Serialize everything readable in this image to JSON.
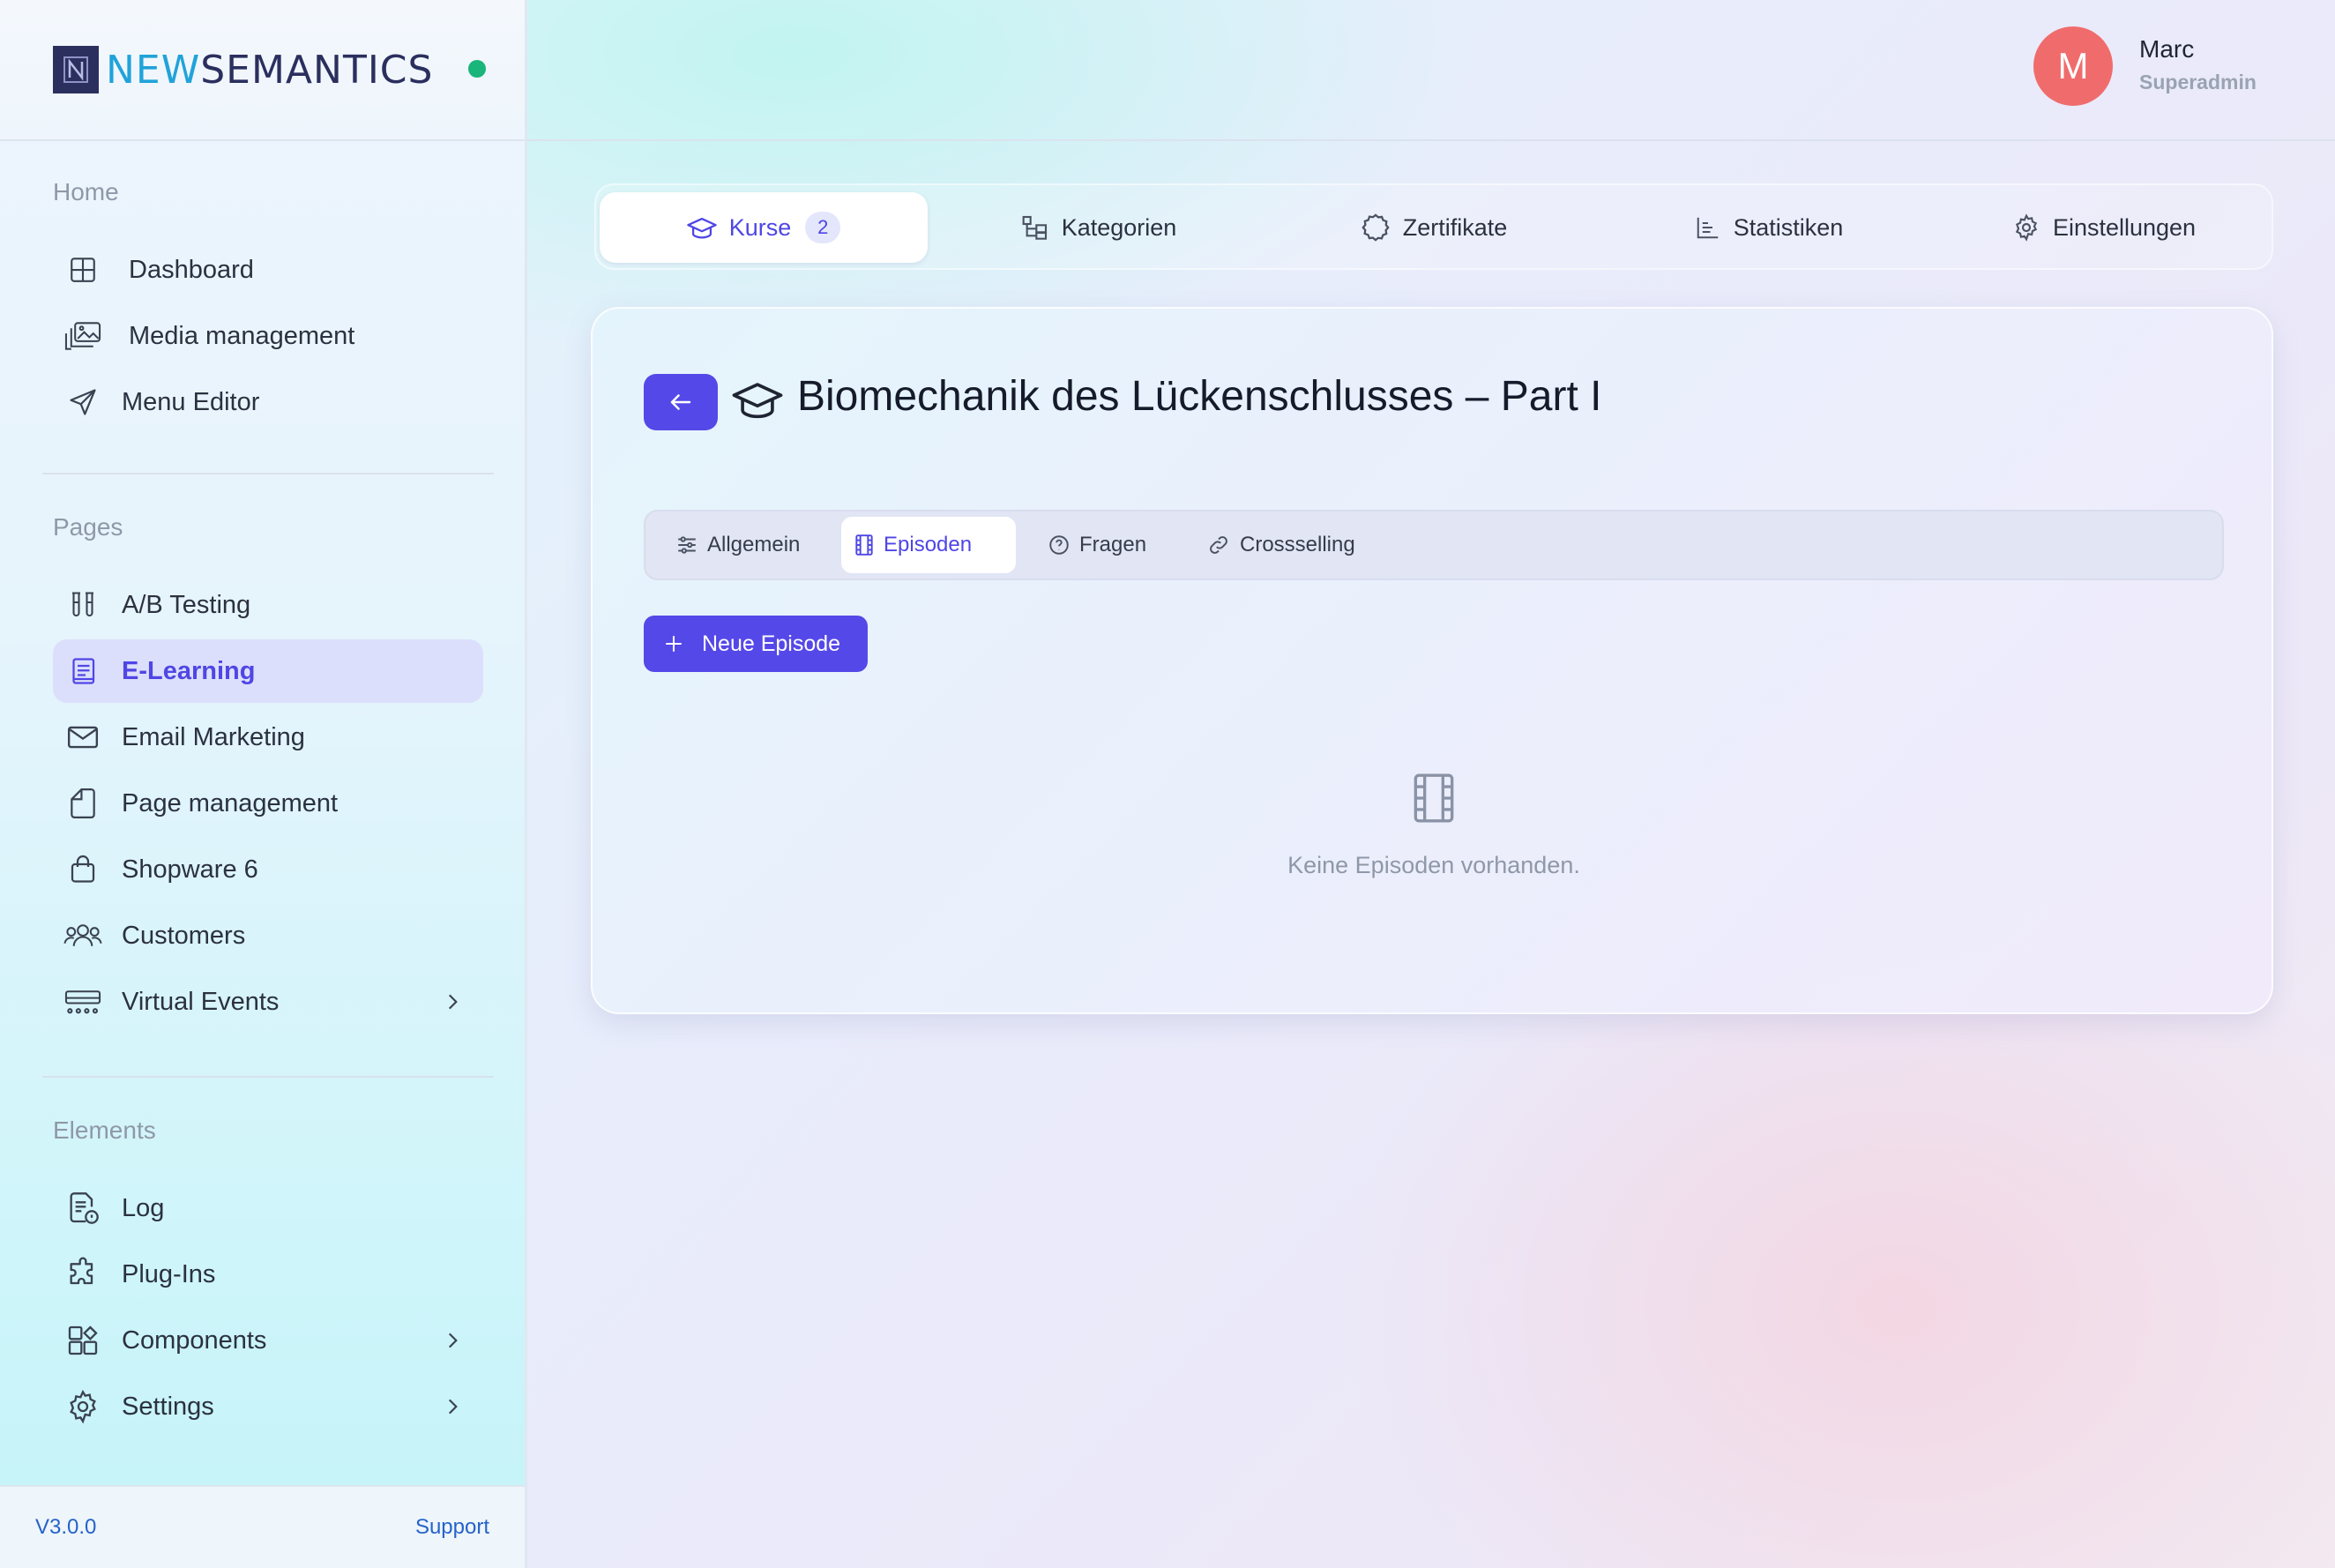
{
  "brand": {
    "part1": "NEW",
    "part2": "SEMANTICS",
    "status_color": "#19b57a"
  },
  "sidebar": {
    "sections": [
      {
        "title": "Home",
        "items": [
          {
            "label": "Dashboard",
            "icon": "grid-icon"
          },
          {
            "label": "Media management",
            "icon": "images-icon"
          },
          {
            "label": "Menu Editor",
            "icon": "send-icon"
          }
        ]
      },
      {
        "title": "Pages",
        "items": [
          {
            "label": "A/B Testing",
            "icon": "test-tubes-icon"
          },
          {
            "label": "E-Learning",
            "icon": "book-icon",
            "active": true
          },
          {
            "label": "Email Marketing",
            "icon": "mail-icon"
          },
          {
            "label": "Page management",
            "icon": "file-icon"
          },
          {
            "label": "Shopware 6",
            "icon": "shopping-bag-icon"
          },
          {
            "label": "Customers",
            "icon": "users-icon"
          },
          {
            "label": "Virtual Events",
            "icon": "events-icon",
            "has_children": true
          }
        ]
      },
      {
        "title": "Elements",
        "items": [
          {
            "label": "Log",
            "icon": "log-file-icon"
          },
          {
            "label": "Plug-Ins",
            "icon": "puzzle-icon"
          },
          {
            "label": "Components",
            "icon": "components-icon",
            "has_children": true
          },
          {
            "label": "Settings",
            "icon": "gear-icon",
            "has_children": true
          }
        ]
      }
    ],
    "footer": {
      "version": "V3.0.0",
      "support": "Support"
    }
  },
  "user": {
    "initial": "M",
    "name": "Marc",
    "role": "Superadmin",
    "avatar_color": "#f06c6c"
  },
  "top_tabs": [
    {
      "label": "Kurse",
      "badge": "2",
      "icon": "graduation-cap-icon",
      "active": true
    },
    {
      "label": "Kategorien",
      "icon": "category-tree-icon"
    },
    {
      "label": "Zertifikate",
      "icon": "badge-icon"
    },
    {
      "label": "Statistiken",
      "icon": "chart-icon"
    },
    {
      "label": "Einstellungen",
      "icon": "gear-icon"
    }
  ],
  "course": {
    "title": "Biomechanik des Lückenschlusses – Part I",
    "sub_tabs": [
      {
        "label": "Allgemein",
        "icon": "sliders-icon"
      },
      {
        "label": "Episoden",
        "icon": "film-icon",
        "active": true
      },
      {
        "label": "Fragen",
        "icon": "question-icon"
      },
      {
        "label": "Crossselling",
        "icon": "link-icon"
      }
    ],
    "new_button": "Neue Episode",
    "empty_message": "Keine Episoden vorhanden."
  },
  "colors": {
    "accent": "#5548e8",
    "accent_text": "#4f46e5"
  }
}
